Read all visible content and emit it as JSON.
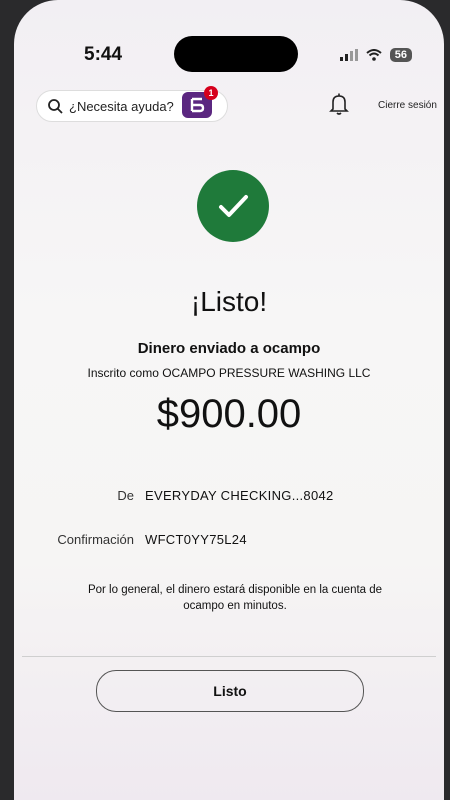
{
  "status_bar": {
    "time": "5:44",
    "battery": "56"
  },
  "header": {
    "search_placeholder": "¿Necesita ayuda?",
    "logo_badge_count": "1",
    "logout_label": "Cierre sesión"
  },
  "confirmation": {
    "title": "¡Listo!",
    "subtitle": "Dinero enviado a ocampo",
    "enrolled_as": "Inscrito como OCAMPO PRESSURE WASHING LLC",
    "amount": "$900.00",
    "from_label": "De",
    "from_value": "EVERYDAY CHECKING...8042",
    "confirmation_label": "Confirmación",
    "confirmation_value": "WFCT0YY75L24",
    "note": "Por lo general, el dinero estará disponible en la cuenta de ocampo en minutos.",
    "done_label": "Listo"
  },
  "colors": {
    "success": "#1f7a3a",
    "brand": "#5b2780",
    "badge": "#d6001c"
  },
  "icons": [
    "search-icon",
    "fargo-logo-icon",
    "bell-icon",
    "check-icon",
    "signal-icon",
    "wifi-icon",
    "battery-icon"
  ]
}
